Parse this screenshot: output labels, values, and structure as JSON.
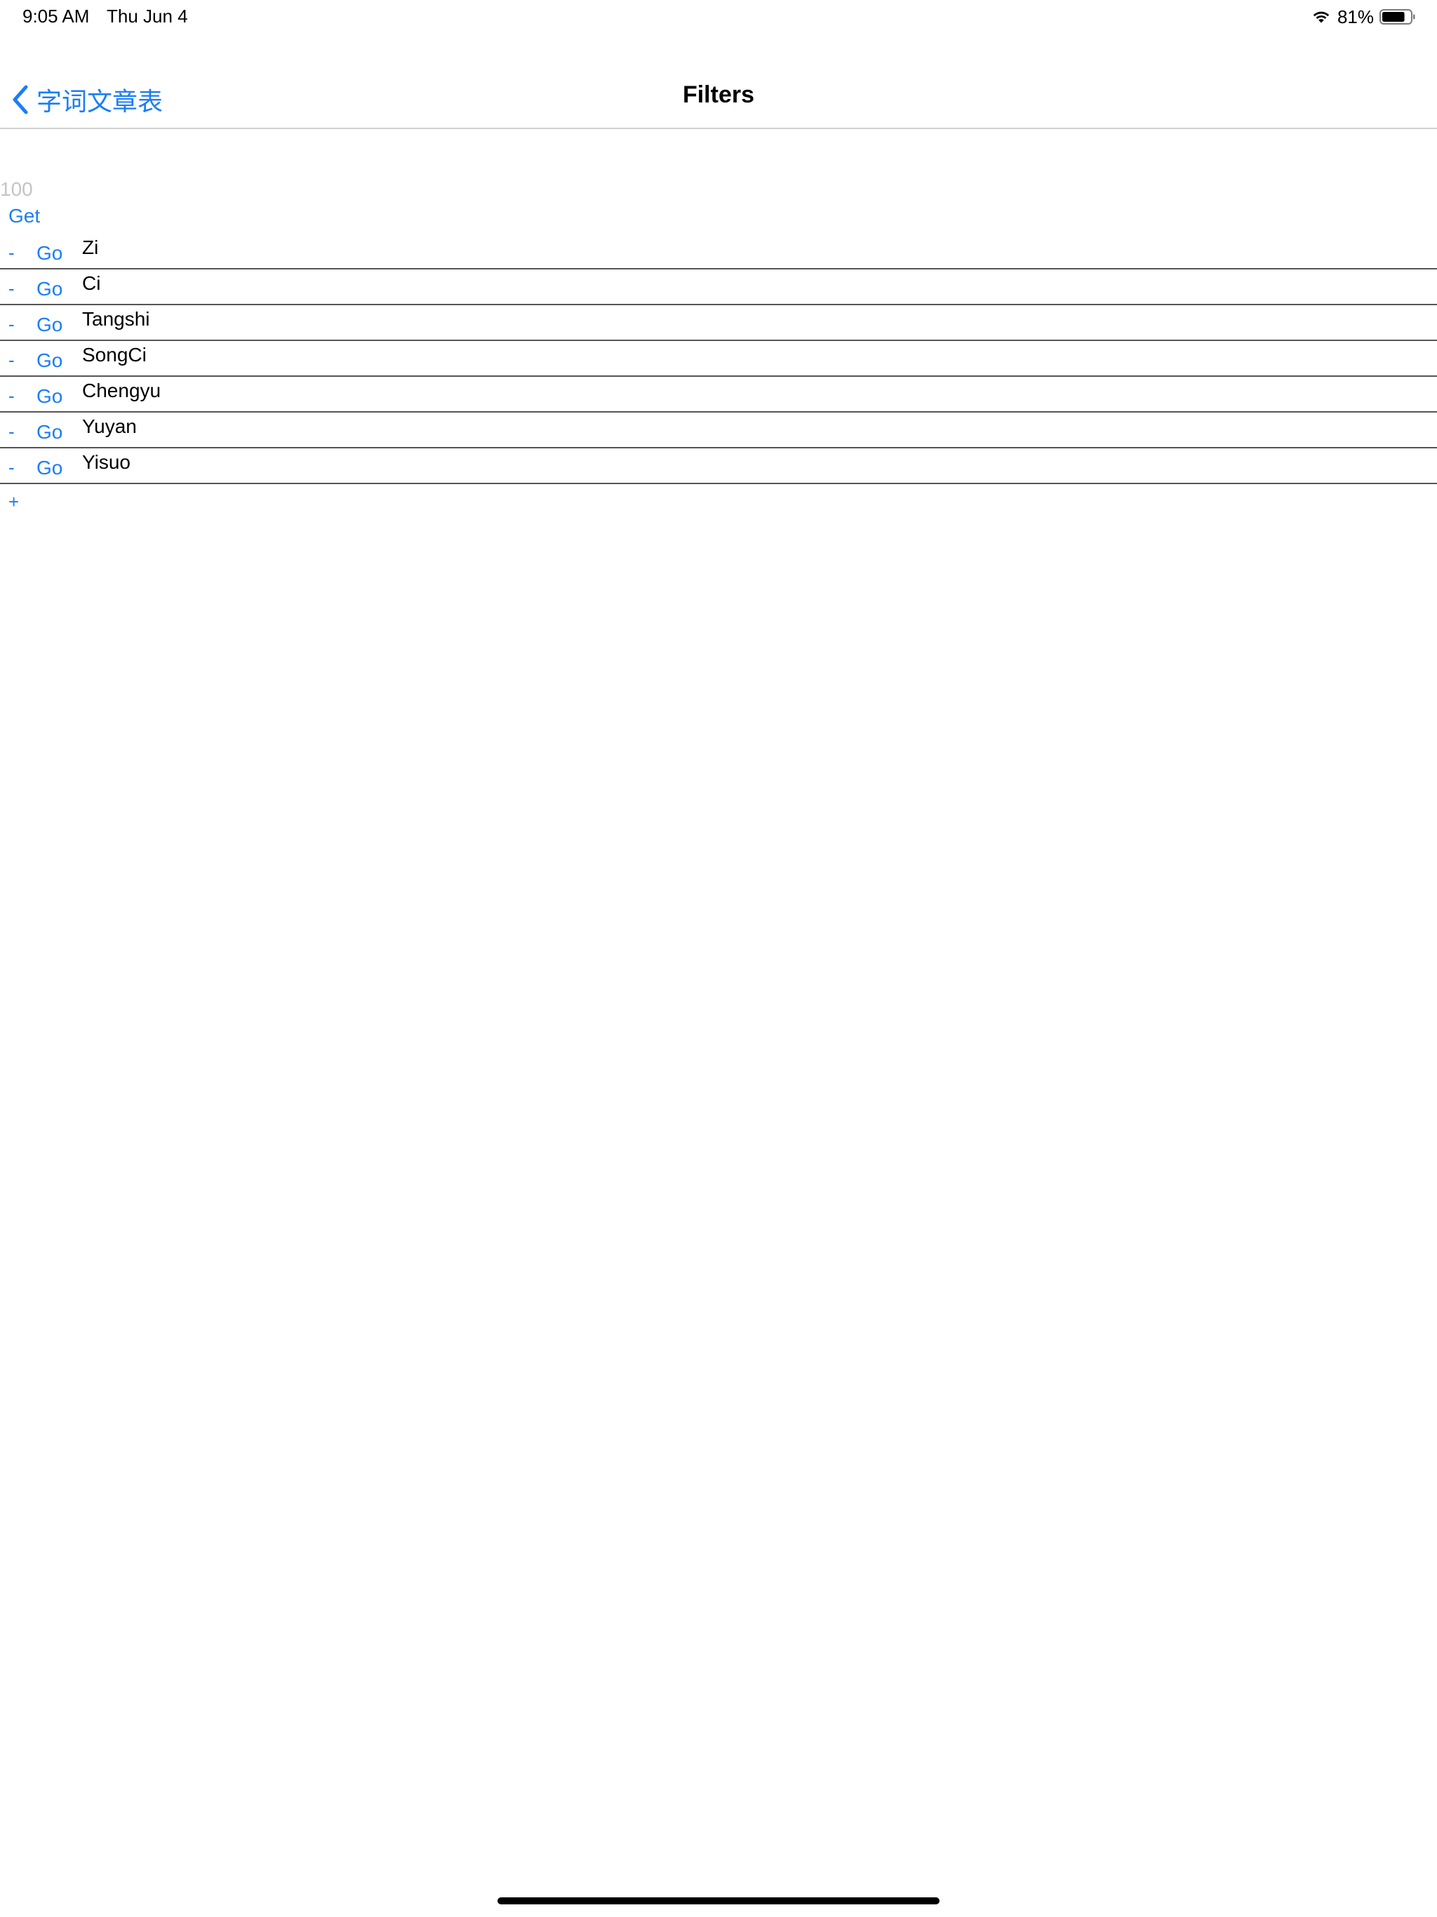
{
  "status_bar": {
    "time": "9:05 AM",
    "date": "Thu Jun 4",
    "battery_percent": "81%",
    "battery_level": 0.81,
    "wifi_icon": "wifi-icon",
    "battery_icon": "battery-icon"
  },
  "nav": {
    "back_label": "字词文章表",
    "back_icon": "chevron-left-icon",
    "title": "Filters"
  },
  "colors": {
    "accent": "#1a7ef6",
    "placeholder": "#c4c4c6",
    "separator": "#555555"
  },
  "count_input": {
    "value": "",
    "placeholder": "100"
  },
  "get_label": "Get",
  "filters": [
    {
      "remove_label": "-",
      "go_label": "Go",
      "name": "Zi"
    },
    {
      "remove_label": "-",
      "go_label": "Go",
      "name": "Ci"
    },
    {
      "remove_label": "-",
      "go_label": "Go",
      "name": "Tangshi"
    },
    {
      "remove_label": "-",
      "go_label": "Go",
      "name": "SongCi"
    },
    {
      "remove_label": "-",
      "go_label": "Go",
      "name": "Chengyu"
    },
    {
      "remove_label": "-",
      "go_label": "Go",
      "name": "Yuyan"
    },
    {
      "remove_label": "-",
      "go_label": "Go",
      "name": "Yisuo"
    }
  ],
  "add_label": "+"
}
